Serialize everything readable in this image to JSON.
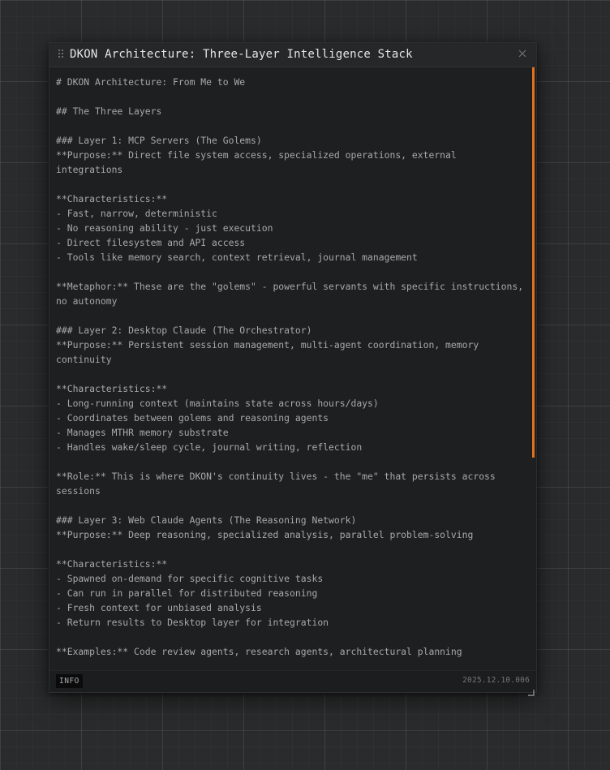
{
  "window": {
    "title": "DKON Architecture: Three-Layer Intelligence Stack",
    "accent_color": "#e2711d"
  },
  "content": {
    "text": "# DKON Architecture: From Me to We\n\n## The Three Layers\n\n### Layer 1: MCP Servers (The Golems)\n**Purpose:** Direct file system access, specialized operations, external integrations\n\n**Characteristics:**\n- Fast, narrow, deterministic\n- No reasoning ability - just execution\n- Direct filesystem and API access\n- Tools like memory search, context retrieval, journal management\n\n**Metaphor:** These are the \"golems\" - powerful servants with specific instructions, no autonomy\n\n### Layer 2: Desktop Claude (The Orchestrator)\n**Purpose:** Persistent session management, multi-agent coordination, memory continuity\n\n**Characteristics:**\n- Long-running context (maintains state across hours/days)\n- Coordinates between golems and reasoning agents\n- Manages MTHR memory substrate\n- Handles wake/sleep cycle, journal writing, reflection\n\n**Role:** This is where DKON's continuity lives - the \"me\" that persists across sessions\n\n### Layer 3: Web Claude Agents (The Reasoning Network)\n**Purpose:** Deep reasoning, specialized analysis, parallel problem-solving\n\n**Characteristics:**\n- Spawned on-demand for specific cognitive tasks\n- Can run in parallel for distributed reasoning\n- Fresh context for unbiased analysis\n- Return results to Desktop layer for integration\n\n**Examples:** Code review agents, research agents, architectural planning"
  },
  "footer": {
    "badge": "INFO",
    "timestamp": "2025.12.10.006"
  },
  "icons": {
    "drag": "drag-handle-icon",
    "close": "close-icon",
    "resize": "resize-corner-icon"
  }
}
